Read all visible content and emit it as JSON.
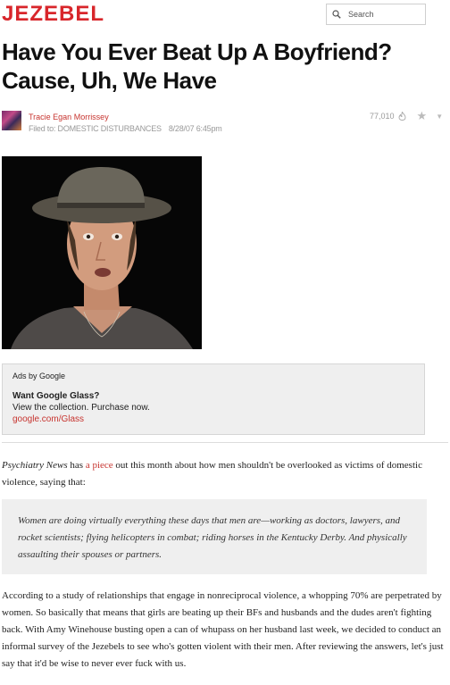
{
  "site": {
    "logo": "JEZEBEL"
  },
  "search": {
    "placeholder": "Search"
  },
  "article": {
    "title": "Have You Ever Beat Up A Boyfriend? Cause, Uh, We Have",
    "author": "Tracie Egan Morrissey",
    "filed_prefix": "Filed to: ",
    "category": "DOMESTIC DISTURBANCES",
    "date": "8/28/07 6:45pm",
    "views": "77,010"
  },
  "ad": {
    "label": "Ads by Google",
    "title": "Want Google Glass?",
    "description": "View the collection. Purchase now.",
    "url": "google.com/Glass"
  },
  "body": {
    "p1_source": "Psychiatry News",
    "p1_a": " has ",
    "p1_link": "a piece",
    "p1_b": " out this month about how men shouldn't be overlooked as victims of domestic violence, saying that:",
    "quote": "Women are doing virtually everything these days that men are—working as doctors, lawyers, and rocket scientists; flying helicopters in combat; riding horses in the Kentucky Derby. And physically assaulting their spouses or partners.",
    "p2": "According to a study of relationships that engage in nonreciprocal violence, a whopping 70% are perpetrated by women. So basically that means that girls are beating up their BFs and husbands and the dudes aren't fighting back. With Amy Winehouse busting open a can of whupass on her husband last week, we decided to conduct an informal survey of the Jezebels to see who's gotten violent with their men. After reviewing the answers, let's just say that it'd be wise to never ever fuck with us."
  },
  "colors": {
    "brand": "#d8262b",
    "link": "#c7342f",
    "muted": "#999999",
    "quote_bg": "#efefef"
  }
}
